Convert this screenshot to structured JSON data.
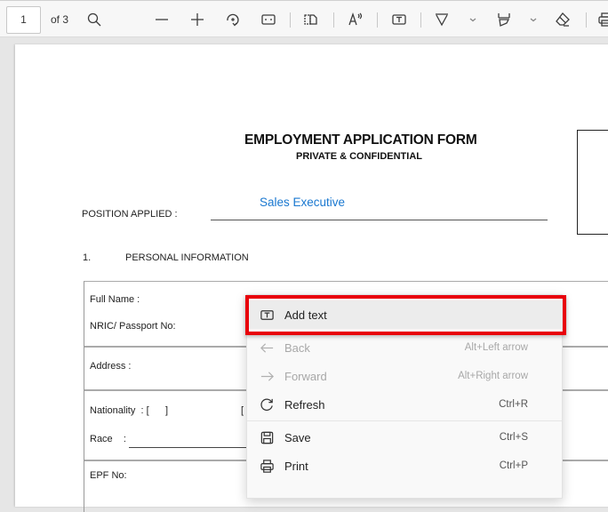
{
  "toolbar": {
    "page_number": "1",
    "page_total": "of 3",
    "icons": [
      "search-icon",
      "zoom-out-icon",
      "zoom-in-icon",
      "rotate-icon",
      "fit-width-icon",
      "page-view-icon",
      "read-aloud-icon",
      "add-text-icon",
      "draw-icon",
      "draw-options-chevron",
      "highlight-icon",
      "highlight-options-chevron",
      "eraser-icon",
      "print-icon"
    ]
  },
  "document": {
    "title": "EMPLOYMENT APPLICATION FORM",
    "subtitle": "PRIVATE & CONFIDENTIAL",
    "position_label": "POSITION APPLIED :",
    "position_value": "Sales Executive",
    "section_number": "1.",
    "section_title": "PERSONAL INFORMATION",
    "fields": {
      "full_name": "Full Name :",
      "nric": "NRIC/ Passport No:",
      "address": "Address :",
      "nationality": "Nationality  : [      ]",
      "nationality_bracket2": "[",
      "race": "Race    :",
      "epf": "EPF No:"
    }
  },
  "context_menu": {
    "items": [
      {
        "label": "Add text",
        "shortcut": "",
        "icon": "add-text-icon",
        "enabled": true
      },
      {
        "label": "Back",
        "shortcut": "Alt+Left arrow",
        "icon": "back-arrow-icon",
        "enabled": false
      },
      {
        "label": "Forward",
        "shortcut": "Alt+Right arrow",
        "icon": "forward-arrow-icon",
        "enabled": false
      },
      {
        "label": "Refresh",
        "shortcut": "Ctrl+R",
        "icon": "refresh-icon",
        "enabled": true
      },
      {
        "label": "Save",
        "shortcut": "Ctrl+S",
        "icon": "save-icon",
        "enabled": true
      },
      {
        "label": "Print",
        "shortcut": "Ctrl+P",
        "icon": "print-icon",
        "enabled": true
      }
    ],
    "highlight_color": "#e8000b"
  }
}
